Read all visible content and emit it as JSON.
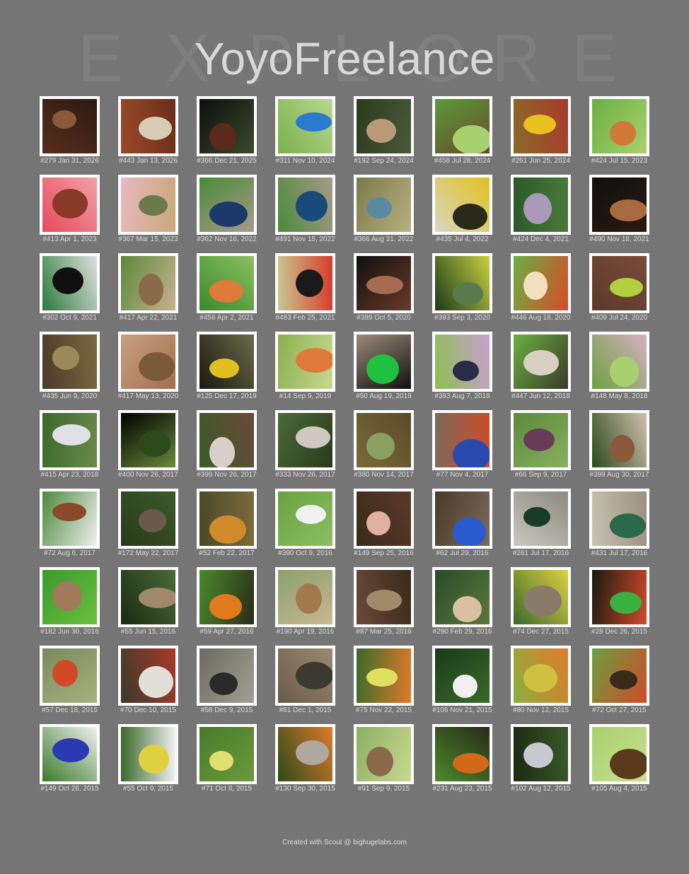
{
  "title": "YoyoFreelance",
  "background_word": [
    "E",
    "X",
    "P",
    "L",
    "O",
    "R",
    "E"
  ],
  "footer": "Created with Scout @ bighugelabs.com",
  "colors": {
    "background": "#757575",
    "title": "#d9d9d9",
    "frame": "#ffffff",
    "caption": "#dcdcdc"
  },
  "photos": [
    {
      "caption": "#279 Jan 31, 2026",
      "tones": [
        "#5a2e1c",
        "#8a5a3a",
        "#2a1a12"
      ]
    },
    {
      "caption": "#443 Jan 13, 2026",
      "tones": [
        "#9a4a2a",
        "#d8cbb4",
        "#6a2e1a"
      ]
    },
    {
      "caption": "#366 Dec 21, 2025",
      "tones": [
        "#0e0e0e",
        "#5a2a1a",
        "#3a4a2a"
      ]
    },
    {
      "caption": "#311 Nov 10, 2024",
      "tones": [
        "#7ab04a",
        "#2a7ad0",
        "#b8d890"
      ]
    },
    {
      "caption": "#192 Sep 24, 2024",
      "tones": [
        "#2a3a1a",
        "#b89a7a",
        "#4a5a3a"
      ]
    },
    {
      "caption": "#458 Jul 28, 2024",
      "tones": [
        "#5a9a3a",
        "#a8d070",
        "#6a4a2a"
      ]
    },
    {
      "caption": "#261 Jun 25, 2024",
      "tones": [
        "#8a6a2a",
        "#e8c020",
        "#a83a2a"
      ]
    },
    {
      "caption": "#424 Jul 15, 2023",
      "tones": [
        "#6ab040",
        "#d07a3a",
        "#a8d070"
      ]
    },
    {
      "caption": "#413 Apr 1, 2023",
      "tones": [
        "#e84a5a",
        "#8a3a2a",
        "#f0a0a8"
      ]
    },
    {
      "caption": "#367 Mar 15, 2023",
      "tones": [
        "#e8b8c0",
        "#6a7a4a",
        "#c8a878"
      ]
    },
    {
      "caption": "#362 Nov 16, 2022",
      "tones": [
        "#4a8a3a",
        "#1a3a6a",
        "#a89a8a"
      ]
    },
    {
      "caption": "#491 Nov 15, 2022",
      "tones": [
        "#4a8a3a",
        "#1a4a7a",
        "#a89a8a"
      ]
    },
    {
      "caption": "#366 Aug 31, 2022",
      "tones": [
        "#7a7a4a",
        "#5a8aa0",
        "#b8b080"
      ]
    },
    {
      "caption": "#435 Jul 4, 2022",
      "tones": [
        "#d8d8c0",
        "#2a2a1a",
        "#e0c020"
      ]
    },
    {
      "caption": "#424 Dec 4, 2021",
      "tones": [
        "#2a5a2a",
        "#a89ab8",
        "#4a7a3a"
      ]
    },
    {
      "caption": "#490 Nov 18, 2021",
      "tones": [
        "#101010",
        "#a86a40",
        "#2a1a10"
      ]
    },
    {
      "caption": "#302 Oct 9, 2021",
      "tones": [
        "#2a7a3a",
        "#101010",
        "#e0e0e0"
      ]
    },
    {
      "caption": "#417 Apr 22, 2021",
      "tones": [
        "#5a8a3a",
        "#8a6a4a",
        "#c8b090"
      ]
    },
    {
      "caption": "#456 Apr 2, 2021",
      "tones": [
        "#3a8a2a",
        "#e07a3a",
        "#8ac060"
      ]
    },
    {
      "caption": "#483 Feb 25, 2021",
      "tones": [
        "#c8c890",
        "#1a1a1a",
        "#d83a2a"
      ]
    },
    {
      "caption": "#389 Oct 5, 2020",
      "tones": [
        "#101010",
        "#a86a50",
        "#6a3a2a"
      ]
    },
    {
      "caption": "#393 Sep 3, 2020",
      "tones": [
        "#1a3a1a",
        "#5a7a4a",
        "#c8d040"
      ]
    },
    {
      "caption": "#446 Aug 18, 2020",
      "tones": [
        "#6ab040",
        "#f0e0c0",
        "#d84a2a"
      ]
    },
    {
      "caption": "#409 Jul 24, 2020",
      "tones": [
        "#5a3a2a",
        "#b0d040",
        "#7a4a3a"
      ]
    },
    {
      "caption": "#435 Jun 9, 2020",
      "tones": [
        "#4a3a2a",
        "#9a8a5a",
        "#7a6a40"
      ]
    },
    {
      "caption": "#417 May 13, 2020",
      "tones": [
        "#c8a080",
        "#7a5a3a",
        "#a07050"
      ]
    },
    {
      "caption": "#125 Dec 17, 2019",
      "tones": [
        "#1a1a10",
        "#e0c020",
        "#6a6a4a"
      ]
    },
    {
      "caption": "#14 Sep 9, 2019",
      "tones": [
        "#8ab050",
        "#e07a3a",
        "#c8d890"
      ]
    },
    {
      "caption": "#50 Aug 19, 2019",
      "tones": [
        "#9a8a7a",
        "#20c040",
        "#101010"
      ]
    },
    {
      "caption": "#393 Aug 7, 2018",
      "tones": [
        "#8ac050",
        "#2a2a4a",
        "#c8a0d0"
      ]
    },
    {
      "caption": "#447 Jun 12, 2018",
      "tones": [
        "#6ab040",
        "#d8d0c0",
        "#3a3a2a"
      ]
    },
    {
      "caption": "#148 May 8, 2018",
      "tones": [
        "#6aa040",
        "#a8d070",
        "#d8b0c0"
      ]
    },
    {
      "caption": "#415 Apr 23, 2018",
      "tones": [
        "#3a6a2a",
        "#e0e0e8",
        "#6a8a4a"
      ]
    },
    {
      "caption": "#400 Nov 26, 2017",
      "tones": [
        "#000000",
        "#2a4a1a",
        "#6a8a3a"
      ]
    },
    {
      "caption": "#399 Nov 26, 2017",
      "tones": [
        "#3a5a2a",
        "#d8d0c8",
        "#6a4a3a"
      ]
    },
    {
      "caption": "#333 Nov 26, 2017",
      "tones": [
        "#4a6a3a",
        "#d0c8c0",
        "#2a3a1a"
      ]
    },
    {
      "caption": "#380 Nov 14, 2017",
      "tones": [
        "#7a6a3a",
        "#8aa060",
        "#5a4a2a"
      ]
    },
    {
      "caption": "#77 Nov 4, 2017",
      "tones": [
        "#7a6a5a",
        "#2a4ab0",
        "#d04a2a"
      ]
    },
    {
      "caption": "#66 Sep 9, 2017",
      "tones": [
        "#5a8a3a",
        "#6a3a5a",
        "#8ab060"
      ]
    },
    {
      "caption": "#399 Aug 30, 2017",
      "tones": [
        "#2a4a1a",
        "#8a5a3a",
        "#d0c0b0"
      ]
    },
    {
      "caption": "#72 Aug 6, 2017",
      "tones": [
        "#4a8a3a",
        "#8a4a2a",
        "#f0f0f0"
      ]
    },
    {
      "caption": "#172 May 22, 2017",
      "tones": [
        "#2a3a1a",
        "#6a5a4a",
        "#3a5a2a"
      ]
    },
    {
      "caption": "#52 Feb 22, 2017",
      "tones": [
        "#4a4a2a",
        "#d08a2a",
        "#7a6a3a"
      ]
    },
    {
      "caption": "#390 Oct 9, 2016",
      "tones": [
        "#6aa040",
        "#f0f0f0",
        "#8ac060"
      ]
    },
    {
      "caption": "#149 Sep 25, 2016",
      "tones": [
        "#3a2a1a",
        "#e0b0a0",
        "#5a3a2a"
      ]
    },
    {
      "caption": "#62 Jul 29, 2016",
      "tones": [
        "#4a3a2a",
        "#2a5ad0",
        "#7a6a5a"
      ]
    },
    {
      "caption": "#261 Jul 17, 2016",
      "tones": [
        "#c8c8c0",
        "#1a3a2a",
        "#8a8a80"
      ]
    },
    {
      "caption": "#431 Jul 17, 2016",
      "tones": [
        "#c8c0b0",
        "#2a6a4a",
        "#9a9080"
      ]
    },
    {
      "caption": "#182 Jun 30, 2016",
      "tones": [
        "#3a9a2a",
        "#a07a5a",
        "#6ac040"
      ]
    },
    {
      "caption": "#55 Jun 15, 2016",
      "tones": [
        "#1a2a10",
        "#a08a6a",
        "#4a6a3a"
      ]
    },
    {
      "caption": "#59 Apr 27, 2016",
      "tones": [
        "#4a8a2a",
        "#e07a1a",
        "#2a2a1a"
      ]
    },
    {
      "caption": "#190 Apr 19, 2016",
      "tones": [
        "#8aa070",
        "#a07a4a",
        "#c8b890"
      ]
    },
    {
      "caption": "#87 Mar 25, 2016",
      "tones": [
        "#6a4a3a",
        "#a08a6a",
        "#3a2a1a"
      ]
    },
    {
      "caption": "#290 Feb 29, 2016",
      "tones": [
        "#2a4a2a",
        "#d8c0a0",
        "#5a7a3a"
      ]
    },
    {
      "caption": "#74 Dec 27, 2015",
      "tones": [
        "#3a6a2a",
        "#8a7a6a",
        "#e0d040"
      ]
    },
    {
      "caption": "#28 Dec 26, 2015",
      "tones": [
        "#1a1a10",
        "#3ab040",
        "#d04a2a"
      ]
    },
    {
      "caption": "#57 Dec 18, 2015",
      "tones": [
        "#7a8a5a",
        "#d04a2a",
        "#a8b080"
      ]
    },
    {
      "caption": "#70 Dec 10, 2015",
      "tones": [
        "#3a3a2a",
        "#e0e0d8",
        "#a83a2a"
      ]
    },
    {
      "caption": "#58 Dec 9, 2015",
      "tones": [
        "#6a6a60",
        "#2a2a2a",
        "#a0a098"
      ]
    },
    {
      "caption": "#61 Dec 1, 2015",
      "tones": [
        "#6a5a4a",
        "#3a3a30",
        "#9a8a70"
      ]
    },
    {
      "caption": "#75 Nov 22, 2015",
      "tones": [
        "#3a6a2a",
        "#e0e060",
        "#e07a2a"
      ]
    },
    {
      "caption": "#106 Nov 21, 2015",
      "tones": [
        "#1a3a1a",
        "#f0f0f0",
        "#3a6a2a"
      ]
    },
    {
      "caption": "#80 Nov 12, 2015",
      "tones": [
        "#8ab040",
        "#d0c040",
        "#e07a2a"
      ]
    },
    {
      "caption": "#72 Oct 27, 2015",
      "tones": [
        "#6aa040",
        "#3a2a1a",
        "#d04a2a"
      ]
    },
    {
      "caption": "#149 Oct 26, 2015",
      "tones": [
        "#3a7a2a",
        "#2a3ab0",
        "#f0f0f0"
      ]
    },
    {
      "caption": "#55 Oct 9, 2015",
      "tones": [
        "#3a6a2a",
        "#e0d040",
        "#f0f0f0"
      ]
    },
    {
      "caption": "#71 Oct 8, 2015",
      "tones": [
        "#4a7a2a",
        "#e0e070",
        "#6a9a3a"
      ]
    },
    {
      "caption": "#130 Sep 30, 2015",
      "tones": [
        "#2a4a1a",
        "#b0a8a0",
        "#e07a2a"
      ]
    },
    {
      "caption": "#91 Sep 9, 2015",
      "tones": [
        "#8ab060",
        "#8a6a4a",
        "#c8d890"
      ]
    },
    {
      "caption": "#231 Aug 23, 2015",
      "tones": [
        "#4a8a2a",
        "#d06a1a",
        "#2a2a1a"
      ]
    },
    {
      "caption": "#102 Aug 12, 2015",
      "tones": [
        "#1a2a10",
        "#c8c8d0",
        "#3a5a2a"
      ]
    },
    {
      "caption": "#105 Aug 4, 2015",
      "tones": [
        "#a8d070",
        "#5a3a1a",
        "#c8e090"
      ]
    }
  ]
}
